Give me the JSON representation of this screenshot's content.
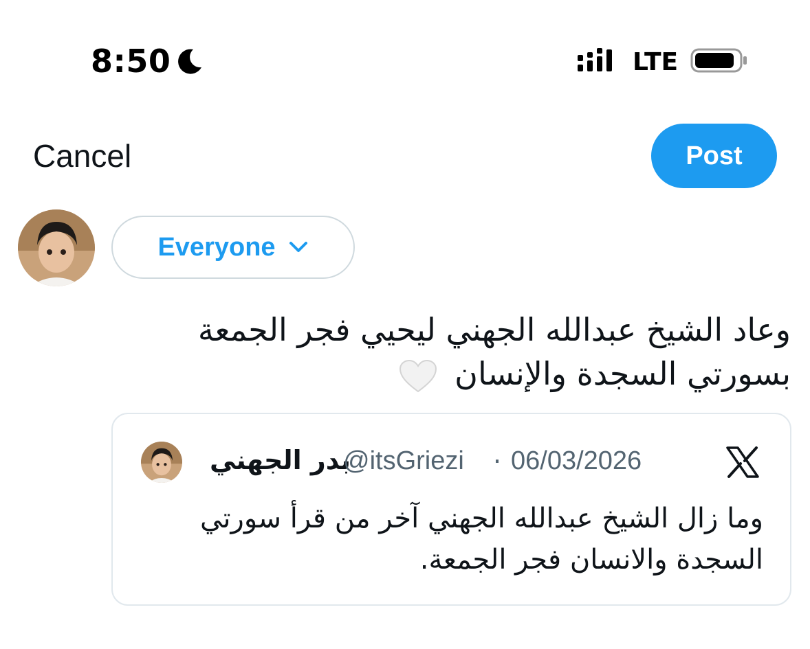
{
  "status_bar": {
    "time": "8:50",
    "network": "LTE",
    "icons": [
      "moon-icon",
      "signal-icon",
      "battery-icon"
    ]
  },
  "header": {
    "cancel_label": "Cancel",
    "post_label": "Post"
  },
  "composer": {
    "audience_label": "Everyone",
    "text_line1": "وعاد الشيخ عبدالله الجهني ليحيي فجر الجمعة",
    "text_line2": "بسورتي السجدة والإنسان",
    "emoji": "white-heart-icon"
  },
  "quoted_post": {
    "display_name": "بدر الجهني",
    "handle": "@itsGriezi",
    "separator": "·",
    "date": "06/03/2026",
    "text_line1": "وما زال الشيخ عبدالله الجهني آخر من قرأ سورتي",
    "text_line2": "السجدة والانسان فجر الجمعة."
  },
  "colors": {
    "accent": "#1d9bf0",
    "text": "#0f1419",
    "secondary_text": "#536471",
    "border": "#cfd9de"
  }
}
